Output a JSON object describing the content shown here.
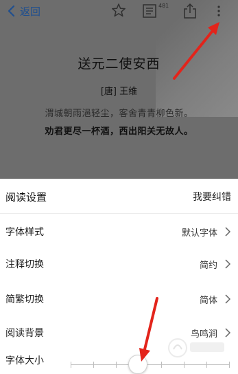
{
  "topbar": {
    "back_label": "返回",
    "icons": [
      "chevron-left-icon",
      "star-icon",
      "document-icon",
      "share-icon",
      "more-icon"
    ],
    "document_badge": "481"
  },
  "poem": {
    "title": "送元二使安西",
    "author": "[唐] 王维",
    "lines": [
      "渭城朝雨浥轻尘，客舍青青柳色新。",
      "劝君更尽一杯酒，西出阳关无故人。"
    ]
  },
  "settings": {
    "header_label": "阅读设置",
    "report_label": "我要纠错",
    "rows": [
      {
        "label": "字体样式",
        "value": "默认字体"
      },
      {
        "label": "注释切换",
        "value": "简约"
      },
      {
        "label": "简繁切换",
        "value": "简体"
      },
      {
        "label": "阅读背景",
        "value": "鸟鸣涧"
      }
    ],
    "font_size": {
      "label": "字体大小",
      "ticks": 8,
      "selected_position": 0.42
    }
  },
  "colors": {
    "accent": "#1f4f8f",
    "annotation_arrow": "#e3241b",
    "dim_overlay": "#6d6d6d"
  }
}
